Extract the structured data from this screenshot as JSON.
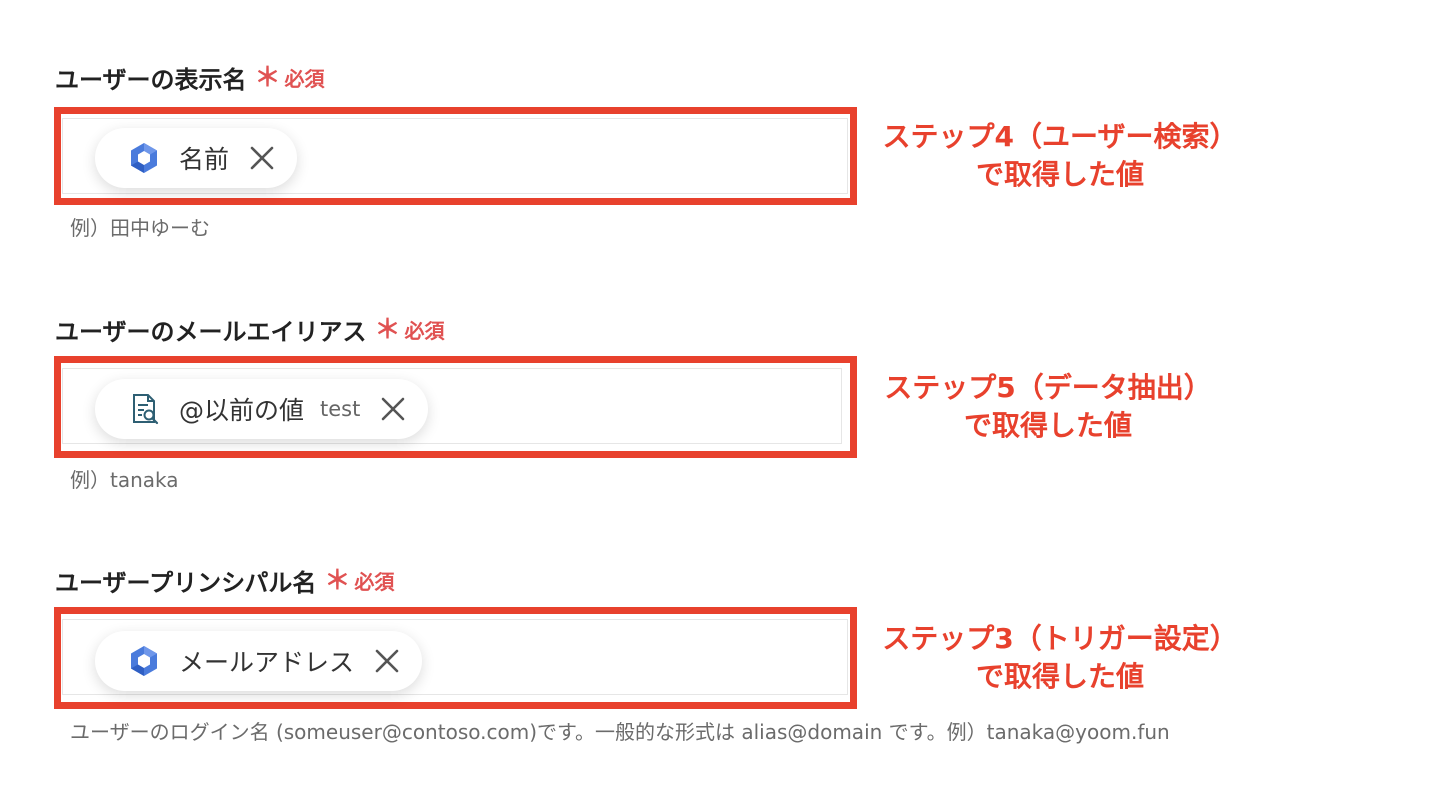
{
  "fields": [
    {
      "label": "ユーザーの表示名",
      "required_mark": "＊",
      "required_text": "必須",
      "chip": {
        "icon": "google-workspace-hexagon-icon",
        "label": "名前",
        "sub": ""
      },
      "helper": "例）田中ゆーむ",
      "annotation_line1": "ステップ4（ユーザー検索）",
      "annotation_line2": "で取得した値"
    },
    {
      "label": "ユーザーのメールエイリアス",
      "required_mark": "＊",
      "required_text": "必須",
      "chip": {
        "icon": "document-search-icon",
        "label": "@以前の値",
        "sub": "test"
      },
      "helper": "例）tanaka",
      "annotation_line1": "ステップ5（データ抽出）",
      "annotation_line2": "で取得した値"
    },
    {
      "label": "ユーザープリンシパル名",
      "required_mark": "＊",
      "required_text": "必須",
      "chip": {
        "icon": "google-workspace-hexagon-icon",
        "label": "メールアドレス",
        "sub": ""
      },
      "helper": "ユーザーのログイン名 (someuser@contoso.com)です。一般的な形式は alias@domain です。例）tanaka@yoom.fun",
      "annotation_line1": "ステップ3（トリガー設定）",
      "annotation_line2": "で取得した値"
    }
  ],
  "colors": {
    "highlight": "#e8412d",
    "required": "#e05252",
    "hex_icon_blue": "#4a7bdc"
  }
}
